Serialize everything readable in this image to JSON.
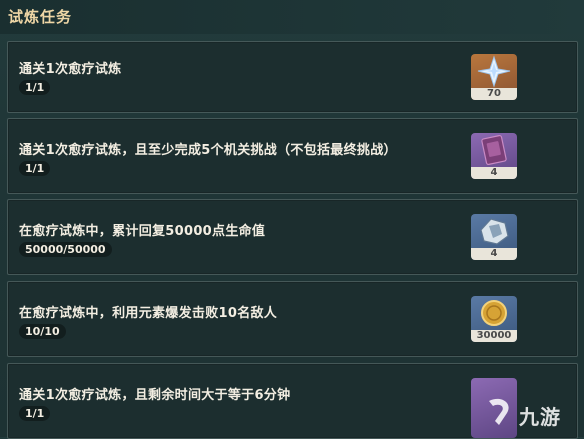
{
  "header": {
    "title": "试炼任务"
  },
  "tasks": [
    {
      "desc": "通关1次愈疗试炼",
      "progress": "1/1",
      "reward": {
        "icon": "primogem-icon",
        "count": "70"
      }
    },
    {
      "desc": "通关1次愈疗试炼，且至少完成5个机关挑战（不包括最终挑战）",
      "progress": "1/1",
      "reward": {
        "icon": "hero-wit-book-icon",
        "count": "4"
      }
    },
    {
      "desc": "在愈疗试炼中，累计回复50000点生命值",
      "progress": "50000/50000",
      "reward": {
        "icon": "mystic-enhancement-ore-icon",
        "count": "4"
      }
    },
    {
      "desc": "在愈疗试炼中，利用元素爆发击败10名敌人",
      "progress": "10/10",
      "reward": {
        "icon": "mora-coin-icon",
        "count": "30000"
      }
    },
    {
      "desc": "通关1次愈疗试炼，且剩余时间大于等于6分钟",
      "progress": "1/1",
      "reward": {
        "icon": "reward-icon",
        "count": ""
      }
    }
  ],
  "watermark": {
    "text": "九游"
  }
}
